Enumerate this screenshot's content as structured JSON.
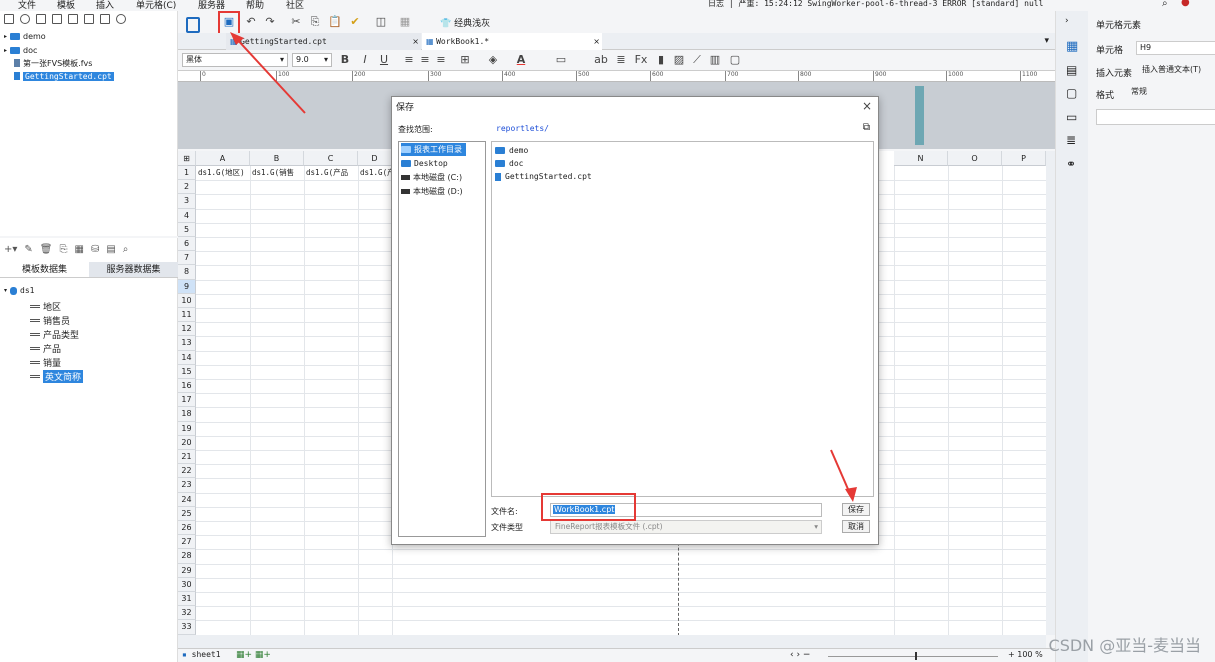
{
  "menu": {
    "items": [
      "文件",
      "模板",
      "插入",
      "单元格(C)",
      "服务器",
      "帮助",
      "社区"
    ]
  },
  "log_status": "日志 | 严重: 15:24:12 SwingWorker-pool-6-thread-3 ERROR [standard] null",
  "left_tree": {
    "items": [
      "demo",
      "doc",
      "第一张FVS模板.fvs",
      "GettingStarted.cpt"
    ]
  },
  "dataset_panel": {
    "tabs": [
      "模板数据集",
      "服务器数据集"
    ],
    "dataset": "ds1",
    "fields": [
      "地区",
      "销售员",
      "产品类型",
      "产品",
      "销量",
      "英文简称"
    ]
  },
  "toolbar": {
    "classic_button": "经典浅灰"
  },
  "doc_tabs": [
    "GettingStarted.cpt",
    "WorkBook1.*"
  ],
  "format_bar": {
    "font": "黑体",
    "size": "9.0"
  },
  "ruler_ticks": [
    "0",
    "100",
    "200",
    "300",
    "400",
    "500",
    "600",
    "700",
    "800",
    "900",
    "1000",
    "1100"
  ],
  "grid": {
    "columns": [
      "A",
      "B",
      "C",
      "D",
      "N",
      "O",
      "P"
    ],
    "rows": [
      "1",
      "2",
      "3",
      "4",
      "5",
      "6",
      "7",
      "8",
      "9",
      "10",
      "11",
      "12",
      "13",
      "14",
      "15",
      "16",
      "17",
      "18",
      "19",
      "20",
      "21",
      "22",
      "23",
      "24",
      "25",
      "26",
      "27",
      "28",
      "29",
      "30",
      "31",
      "32",
      "33"
    ],
    "row1_cells": [
      "ds1.G(地区)",
      "ds1.G(销售",
      "ds1.G(产品",
      "ds1.G(产"
    ]
  },
  "status": {
    "sheet": "sheet1",
    "zoom": "100"
  },
  "right_panel": {
    "title": "单元格元素",
    "cell_label": "单元格",
    "cell_value": "H9",
    "insert_label": "插入元素",
    "insert_value": "插入普通文本(T)",
    "format_label": "格式",
    "format_value": "常规"
  },
  "dialog": {
    "title": "保存",
    "look_in_label": "查找范围:",
    "path": "reportlets/",
    "places": [
      "报表工作目录",
      "Desktop",
      "本地磁盘 (C:)",
      "本地磁盘 (D:)"
    ],
    "files": [
      "demo",
      "doc",
      "GettingStarted.cpt"
    ],
    "filename_label": "文件名:",
    "filename_value": "WorkBook1.cpt",
    "filetype_label": "文件类型",
    "filetype_value": "FineReport报表模板文件 (.cpt)",
    "save_button": "保存",
    "cancel_button": "取消"
  },
  "watermark": "CSDN @亚当-麦当当",
  "colors": {
    "accent": "#2e86de",
    "annotation": "#e53935"
  }
}
